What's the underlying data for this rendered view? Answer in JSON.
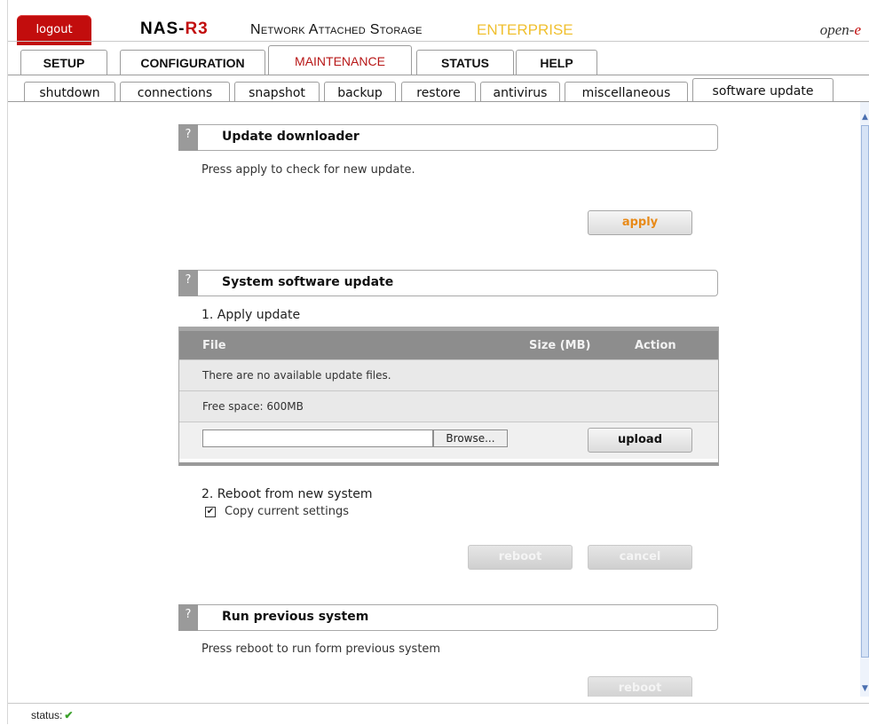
{
  "header": {
    "logout_label": "logout",
    "brand_prefix": "NAS-",
    "brand_suffix": "R3",
    "tagline": "Network Attached Storage",
    "edition": "ENTERPRISE",
    "logo_prefix": "open-",
    "logo_suffix": "e"
  },
  "main_tabs": [
    "SETUP",
    "CONFIGURATION",
    "MAINTENANCE",
    "STATUS",
    "HELP"
  ],
  "main_tabs_active": "MAINTENANCE",
  "sub_tabs": [
    "shutdown",
    "connections",
    "snapshot",
    "backup",
    "restore",
    "antivirus",
    "miscellaneous",
    "software update"
  ],
  "sub_tabs_active": "software update",
  "sections": {
    "downloader": {
      "help": "?",
      "title": "Update downloader",
      "text": "Press apply to check for new update.",
      "apply_label": "apply"
    },
    "system_update": {
      "help": "?",
      "title": "System software update",
      "step1": "1. Apply update",
      "table": {
        "columns": [
          "File",
          "Size (MB)",
          "Action"
        ],
        "empty_message": "There are no available update files.",
        "free_space": "Free space: 600MB",
        "file_value": "",
        "browse_label": "Browse...",
        "upload_label": "upload"
      },
      "step2": "2. Reboot from new system",
      "copy_settings_label": "Copy current settings",
      "copy_settings_checked": true,
      "reboot_label": "reboot",
      "cancel_label": "cancel"
    },
    "previous": {
      "help": "?",
      "title": "Run previous system",
      "text": "Press reboot to run form previous system",
      "reboot_label": "reboot"
    }
  },
  "statusbar": {
    "label": "status:",
    "icon": "check-icon"
  },
  "colors": {
    "brand_red": "#c20d0d",
    "edition_yellow": "#f0c030",
    "apply_orange": "#e88a18",
    "table_header": "#8d8d8d"
  }
}
